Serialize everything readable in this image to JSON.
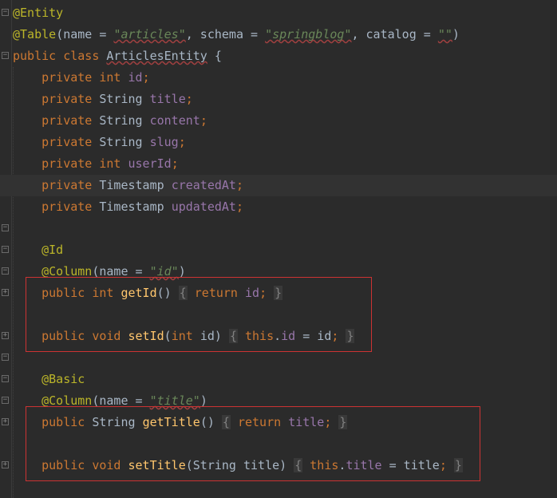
{
  "editor": {
    "lines": [
      {
        "tokens": [
          {
            "c": "ann",
            "t": "@Entity"
          }
        ]
      },
      {
        "tokens": [
          {
            "c": "ann",
            "t": "@Table"
          },
          {
            "c": "txt",
            "t": "(name = "
          },
          {
            "c": "str",
            "t": "\"articles\""
          },
          {
            "c": "txt",
            "t": ", schema = "
          },
          {
            "c": "str",
            "t": "\"springblog\""
          },
          {
            "c": "txt",
            "t": ", catalog = "
          },
          {
            "c": "str",
            "t": "\"\""
          },
          {
            "c": "txt",
            "t": ")"
          }
        ]
      },
      {
        "tokens": [
          {
            "c": "kw",
            "t": "public class "
          },
          {
            "c": "cls",
            "t": "ArticlesEntity"
          },
          {
            "c": "txt",
            "t": " {"
          }
        ]
      },
      {
        "tokens": [
          {
            "c": "txt",
            "t": "    "
          },
          {
            "c": "kw",
            "t": "private int "
          },
          {
            "c": "fld",
            "t": "id"
          },
          {
            "c": "kw",
            "t": ";"
          }
        ]
      },
      {
        "tokens": [
          {
            "c": "txt",
            "t": "    "
          },
          {
            "c": "kw",
            "t": "private "
          },
          {
            "c": "txt",
            "t": "String "
          },
          {
            "c": "fld",
            "t": "title"
          },
          {
            "c": "kw",
            "t": ";"
          }
        ]
      },
      {
        "tokens": [
          {
            "c": "txt",
            "t": "    "
          },
          {
            "c": "kw",
            "t": "private "
          },
          {
            "c": "txt",
            "t": "String "
          },
          {
            "c": "fld",
            "t": "content"
          },
          {
            "c": "kw",
            "t": ";"
          }
        ]
      },
      {
        "tokens": [
          {
            "c": "txt",
            "t": "    "
          },
          {
            "c": "kw",
            "t": "private "
          },
          {
            "c": "txt",
            "t": "String "
          },
          {
            "c": "fld",
            "t": "slug"
          },
          {
            "c": "kw",
            "t": ";"
          }
        ]
      },
      {
        "tokens": [
          {
            "c": "txt",
            "t": "    "
          },
          {
            "c": "kw",
            "t": "private int "
          },
          {
            "c": "fld",
            "t": "userId"
          },
          {
            "c": "kw",
            "t": ";"
          }
        ]
      },
      {
        "tokens": [
          {
            "c": "txt",
            "t": "    "
          },
          {
            "c": "kw",
            "t": "private "
          },
          {
            "c": "txt",
            "t": "Timestamp "
          },
          {
            "c": "fld",
            "t": "createdAt"
          },
          {
            "c": "kw",
            "t": ";"
          }
        ]
      },
      {
        "tokens": [
          {
            "c": "txt",
            "t": "    "
          },
          {
            "c": "kw",
            "t": "private "
          },
          {
            "c": "txt",
            "t": "Timestamp "
          },
          {
            "c": "fld",
            "t": "updatedAt"
          },
          {
            "c": "kw",
            "t": ";"
          }
        ]
      },
      {
        "tokens": []
      },
      {
        "tokens": [
          {
            "c": "txt",
            "t": "    "
          },
          {
            "c": "ann",
            "t": "@Id"
          }
        ]
      },
      {
        "tokens": [
          {
            "c": "txt",
            "t": "    "
          },
          {
            "c": "ann",
            "t": "@Column"
          },
          {
            "c": "txt",
            "t": "(name = "
          },
          {
            "c": "str",
            "t": "\"id\""
          },
          {
            "c": "txt",
            "t": ")"
          }
        ]
      },
      {
        "tokens": [
          {
            "c": "txt",
            "t": "    "
          },
          {
            "c": "kw",
            "t": "public int "
          },
          {
            "c": "fn",
            "t": "getId"
          },
          {
            "c": "txt",
            "t": "() "
          },
          {
            "c": "brace",
            "t": "{"
          },
          {
            "c": "txt",
            "t": " "
          },
          {
            "c": "kw",
            "t": "return "
          },
          {
            "c": "fld",
            "t": "id"
          },
          {
            "c": "kw",
            "t": "; "
          },
          {
            "c": "brace",
            "t": "}"
          }
        ]
      },
      {
        "tokens": []
      },
      {
        "tokens": [
          {
            "c": "txt",
            "t": "    "
          },
          {
            "c": "kw",
            "t": "public void "
          },
          {
            "c": "fn",
            "t": "setId"
          },
          {
            "c": "txt",
            "t": "("
          },
          {
            "c": "kw",
            "t": "int "
          },
          {
            "c": "txt",
            "t": "id) "
          },
          {
            "c": "brace",
            "t": "{"
          },
          {
            "c": "txt",
            "t": " "
          },
          {
            "c": "kw",
            "t": "this"
          },
          {
            "c": "txt",
            "t": "."
          },
          {
            "c": "fld",
            "t": "id"
          },
          {
            "c": "txt",
            "t": " = id"
          },
          {
            "c": "kw",
            "t": "; "
          },
          {
            "c": "brace",
            "t": "}"
          }
        ]
      },
      {
        "tokens": []
      },
      {
        "tokens": [
          {
            "c": "txt",
            "t": "    "
          },
          {
            "c": "ann",
            "t": "@Basic"
          }
        ]
      },
      {
        "tokens": [
          {
            "c": "txt",
            "t": "    "
          },
          {
            "c": "ann",
            "t": "@Column"
          },
          {
            "c": "txt",
            "t": "(name = "
          },
          {
            "c": "str",
            "t": "\"title\""
          },
          {
            "c": "txt",
            "t": ")"
          }
        ]
      },
      {
        "tokens": [
          {
            "c": "txt",
            "t": "    "
          },
          {
            "c": "kw",
            "t": "public "
          },
          {
            "c": "txt",
            "t": "String "
          },
          {
            "c": "fn",
            "t": "getTitle"
          },
          {
            "c": "txt",
            "t": "() "
          },
          {
            "c": "brace",
            "t": "{"
          },
          {
            "c": "txt",
            "t": " "
          },
          {
            "c": "kw",
            "t": "return "
          },
          {
            "c": "fld",
            "t": "title"
          },
          {
            "c": "kw",
            "t": "; "
          },
          {
            "c": "brace",
            "t": "}"
          }
        ]
      },
      {
        "tokens": []
      },
      {
        "tokens": [
          {
            "c": "txt",
            "t": "    "
          },
          {
            "c": "kw",
            "t": "public void "
          },
          {
            "c": "fn",
            "t": "setTitle"
          },
          {
            "c": "txt",
            "t": "(String title) "
          },
          {
            "c": "brace",
            "t": "{"
          },
          {
            "c": "txt",
            "t": " "
          },
          {
            "c": "kw",
            "t": "this"
          },
          {
            "c": "txt",
            "t": "."
          },
          {
            "c": "fld",
            "t": "title"
          },
          {
            "c": "txt",
            "t": " = title"
          },
          {
            "c": "kw",
            "t": "; "
          },
          {
            "c": "brace",
            "t": "}"
          }
        ]
      },
      {
        "tokens": []
      }
    ],
    "current_line": 8,
    "fold_markers": [
      {
        "line": 0,
        "state": "open"
      },
      {
        "line": 2,
        "state": "open"
      },
      {
        "line": 10,
        "state": "open"
      },
      {
        "line": 11,
        "state": "open"
      },
      {
        "line": 12,
        "state": "open"
      },
      {
        "line": 13,
        "state": "closed"
      },
      {
        "line": 15,
        "state": "closed"
      },
      {
        "line": 16,
        "state": "open"
      },
      {
        "line": 17,
        "state": "open"
      },
      {
        "line": 18,
        "state": "open"
      },
      {
        "line": 19,
        "state": "closed"
      },
      {
        "line": 21,
        "state": "closed"
      }
    ],
    "highlight_boxes": [
      {
        "from_line": 13,
        "to_line": 15
      },
      {
        "from_line": 19,
        "to_line": 21
      }
    ]
  },
  "colors": {
    "background": "#2b2b2b",
    "annotation": "#bbb529",
    "keyword": "#cc7832",
    "field": "#9876aa",
    "string": "#6a8759",
    "method": "#ffc66d",
    "highlight_border": "#cc3333"
  }
}
